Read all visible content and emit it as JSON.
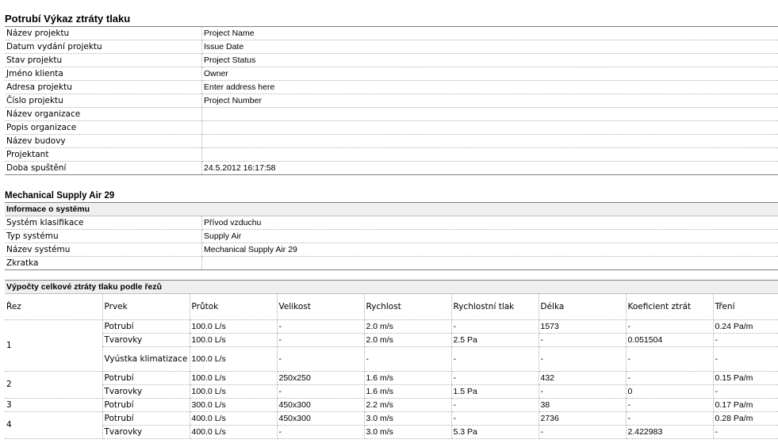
{
  "report_title": "Potrubí Výkaz ztráty tlaku",
  "project_info": [
    {
      "label": "Název projektu",
      "value": "Project Name"
    },
    {
      "label": "Datum vydání projektu",
      "value": "Issue Date"
    },
    {
      "label": "Stav projektu",
      "value": "Project Status"
    },
    {
      "label": "Jméno klienta",
      "value": "Owner"
    },
    {
      "label": "Adresa projektu",
      "value": "Enter address here"
    },
    {
      "label": "Číslo projektu",
      "value": "Project Number"
    },
    {
      "label": "Název organizace",
      "value": ""
    },
    {
      "label": "Popis organizace",
      "value": ""
    },
    {
      "label": "Název budovy",
      "value": ""
    },
    {
      "label": "Projektant",
      "value": ""
    },
    {
      "label": "Doba spuštění",
      "value": "24.5.2012 16:17:58"
    }
  ],
  "system_title": "Mechanical Supply Air 29",
  "system_info_header": "Informace o systému",
  "system_info": [
    {
      "label": "Systém klasifikace",
      "value": "Přívod vzduchu"
    },
    {
      "label": "Typ systému",
      "value": "Supply Air"
    },
    {
      "label": "Název systému",
      "value": "Mechanical Supply Air 29"
    },
    {
      "label": "Zkratka",
      "value": ""
    }
  ],
  "sections_header": "Výpočty celkové ztráty tlaku podle řezů",
  "columns": [
    "Řez",
    "Prvek",
    "Průtok",
    "Velikost",
    "Rychlost",
    "Rychlostní tlak",
    "Délka",
    "Koeficient ztrát",
    "Tření"
  ],
  "sections": [
    {
      "id": "1",
      "rows": [
        [
          "Potrubí",
          "100.0 L/s",
          "-",
          "2.0 m/s",
          "-",
          "1573",
          "-",
          "0.24 Pa/m"
        ],
        [
          "Tvarovky",
          "100.0 L/s",
          "-",
          "2.0 m/s",
          "2.5 Pa",
          "-",
          "0.051504",
          "-"
        ],
        [
          "Vyústka klimatizace",
          "100.0 L/s",
          "-",
          "-",
          "-",
          "-",
          "-",
          "-"
        ]
      ]
    },
    {
      "id": "2",
      "rows": [
        [
          "Potrubí",
          "100.0 L/s",
          "250x250",
          "1.6 m/s",
          "-",
          "432",
          "-",
          "0.15 Pa/m"
        ],
        [
          "Tvarovky",
          "100.0 L/s",
          "-",
          "1.6 m/s",
          "1.5 Pa",
          "-",
          "0",
          "-"
        ]
      ]
    },
    {
      "id": "3",
      "rows": [
        [
          "Potrubí",
          "300.0 L/s",
          "450x300",
          "2.2 m/s",
          "-",
          "38",
          "-",
          "0.17 Pa/m"
        ]
      ]
    },
    {
      "id": "4",
      "rows": [
        [
          "Potrubí",
          "400.0 L/s",
          "450x300",
          "3.0 m/s",
          "-",
          "2736",
          "-",
          "0.28 Pa/m"
        ],
        [
          "Tvarovky",
          "400.0 L/s",
          "-",
          "3.0 m/s",
          "5.3 Pa",
          "-",
          "2.422983",
          "-"
        ]
      ]
    }
  ]
}
